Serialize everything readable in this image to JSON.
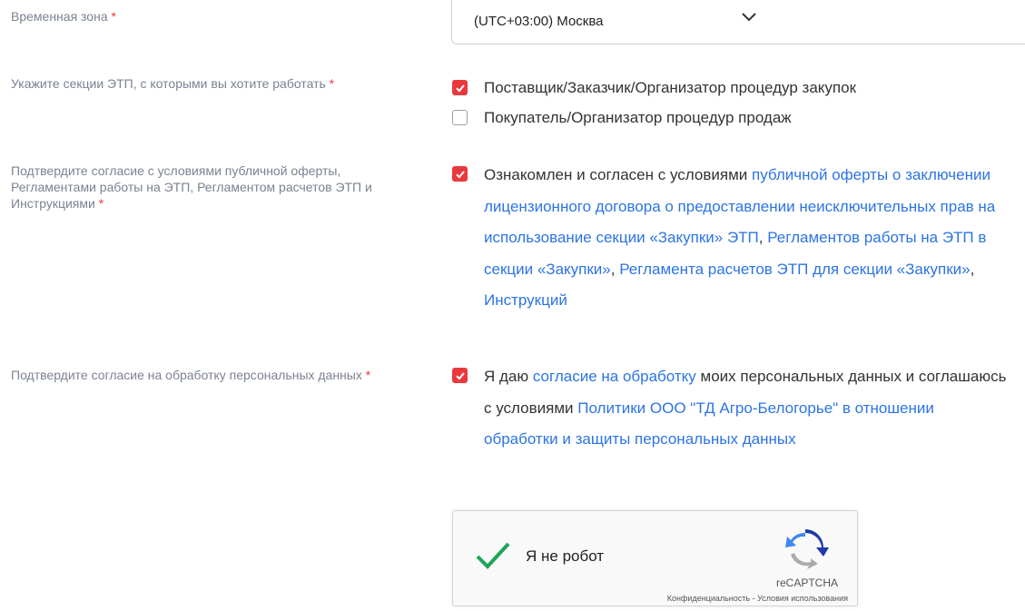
{
  "timezone": {
    "label": "Временная зона",
    "required": "*",
    "value": "(UTC+03:00) Москва",
    "chevron_icon": "chevron-down-icon"
  },
  "sections": {
    "label": "Укажите секции ЭТП, с которыми вы хотите работать",
    "required": "*",
    "options": [
      {
        "label": "Поставщик/Заказчик/Организатор процедур закупок",
        "checked": true
      },
      {
        "label": "Покупатель/Организатор процедур продаж",
        "checked": false
      }
    ]
  },
  "offer": {
    "label": "Подтвердите согласие с условиями публичной оферты, Регламентами работы на ЭТП, Регламентом расчетов ЭТП и Инструкциями",
    "required": "*",
    "checked": true,
    "text_prefix": "Ознакомлен и согласен с условиями ",
    "links": [
      "публичной оферты о заключении лицензионного договора о предоставлении неисключительных прав на использование секции «Закупки» ЭТП",
      "Регламентов работы на ЭТП в секции «Закупки»",
      "Регламента расчетов ЭТП для секции «Закупки»",
      "Инструкций"
    ],
    "separator": ", "
  },
  "personal_data": {
    "label": "Подтвердите согласие на обработку персональных данных",
    "required": "*",
    "checked": true,
    "text_1": "Я даю ",
    "link_1": "согласие на обработку",
    "text_2": " моих персональных данных и соглашаюсь с условиями ",
    "link_2": "Политики ООО \"ТД Агро-Белогорье\" в отношении обработки и защиты персональных данных"
  },
  "captcha": {
    "label": "Я не робот",
    "brand": "reCAPTCHA",
    "privacy": "Конфиденциальность",
    "sep": " - ",
    "terms": "Условия использования",
    "checked": true
  },
  "colors": {
    "accent": "#e8393f",
    "link": "#2c74e4",
    "label": "#7b8291",
    "check_green": "#1fa45a"
  }
}
